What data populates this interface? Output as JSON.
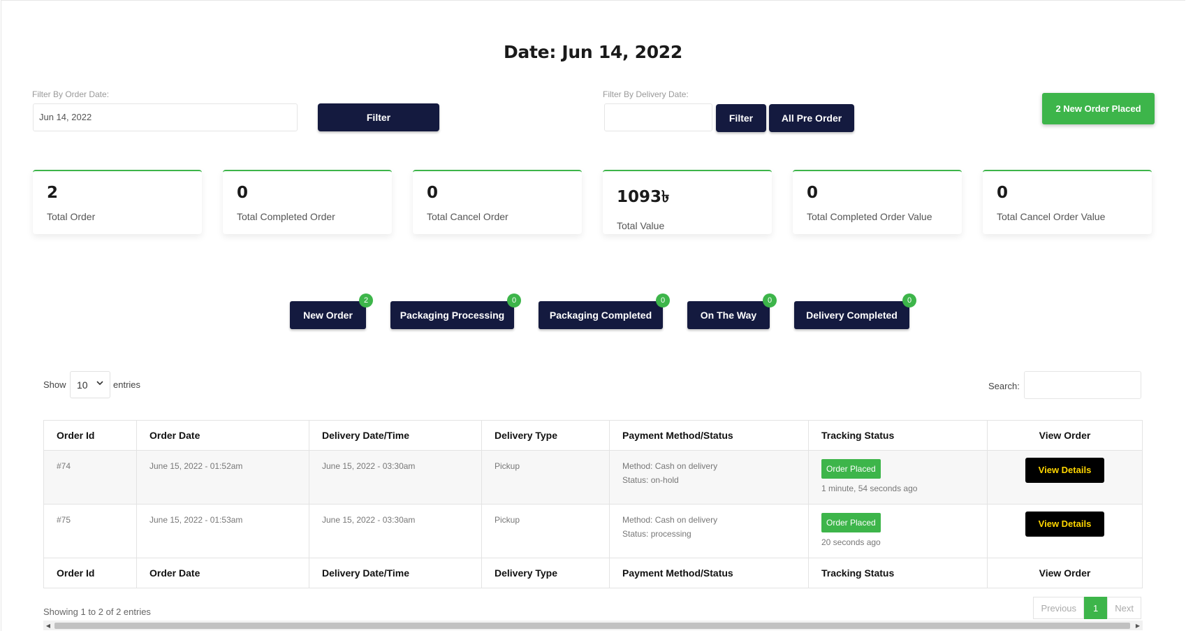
{
  "header": {
    "title": "Date: Jun 14, 2022"
  },
  "filters": {
    "order_label": "Filter By Order Date:",
    "order_value": "Jun 14, 2022",
    "order_filter_btn": "Filter",
    "delivery_label": "Filter By Delivery Date:",
    "delivery_value": "",
    "delivery_filter_btn": "Filter",
    "all_pre_order_btn": "All Pre Order",
    "new_order_placed_btn": "2 New Order Placed"
  },
  "stats": [
    {
      "value": "2",
      "label": "Total Order"
    },
    {
      "value": "0",
      "label": "Total Completed Order"
    },
    {
      "value": "0",
      "label": "Total Cancel Order"
    },
    {
      "value": "1093৳",
      "label": "Total Value"
    },
    {
      "value": "0",
      "label": "Total Completed Order Value"
    },
    {
      "value": "0",
      "label": "Total Cancel Order Value"
    }
  ],
  "status_tabs": [
    {
      "label": "New Order",
      "count": "2"
    },
    {
      "label": "Packaging Processing",
      "count": "0"
    },
    {
      "label": "Packaging Completed",
      "count": "0"
    },
    {
      "label": "On The Way",
      "count": "0"
    },
    {
      "label": "Delivery Completed",
      "count": "0"
    }
  ],
  "table_controls": {
    "show": "Show",
    "page_size": "10",
    "entries": "entries",
    "search_label": "Search:"
  },
  "table": {
    "columns": [
      "Order Id",
      "Order Date",
      "Delivery Date/Time",
      "Delivery Type",
      "Payment Method/Status",
      "Tracking Status",
      "View Order"
    ],
    "rows": [
      {
        "id": "#74",
        "order_date": "June 15, 2022 - 01:52am",
        "delivery": "June 15, 2022 - 03:30am",
        "type": "Pickup",
        "method": "Method: Cash on delivery",
        "status": "Status: on-hold",
        "tracking": "Order Placed",
        "ago": "1 minute, 54 seconds ago",
        "view": "View Details"
      },
      {
        "id": "#75",
        "order_date": "June 15, 2022 - 01:53am",
        "delivery": "June 15, 2022 - 03:30am",
        "type": "Pickup",
        "method": "Method: Cash on delivery",
        "status": "Status: processing",
        "tracking": "Order Placed",
        "ago": "20 seconds ago",
        "view": "View Details"
      }
    ]
  },
  "footer": {
    "info": "Showing 1 to 2 of 2 entries",
    "prev": "Previous",
    "page": "1",
    "next": "Next"
  },
  "colors": {
    "navy": "#141a3f",
    "green": "#3db54a",
    "view_btn_text": "#ffd600"
  }
}
